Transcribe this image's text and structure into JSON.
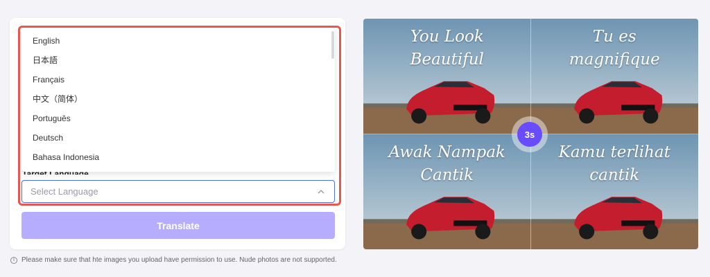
{
  "form": {
    "target_label": "Target Language",
    "select_placeholder": "Select Language",
    "translate_label": "Translate"
  },
  "dropdown": {
    "options": [
      "English",
      "日本語",
      "Français",
      "中文（简体）",
      "Português",
      "Deutsch",
      "Bahasa Indonesia"
    ]
  },
  "disclaimer": "Please make sure that hte images you upload have permission to use. Nude photos are not supported.",
  "preview": {
    "captions": [
      "You Look\nBeautiful",
      "Tu es\nmagnifique",
      "Awak Nampak\nCantik",
      "Kamu terlihat\ncantik"
    ],
    "timer": "3s"
  },
  "colors": {
    "accent": "#6a4cff",
    "button_disabled": "#b7adff",
    "highlight": "#e6584f",
    "select_border": "#4a6cf7"
  }
}
